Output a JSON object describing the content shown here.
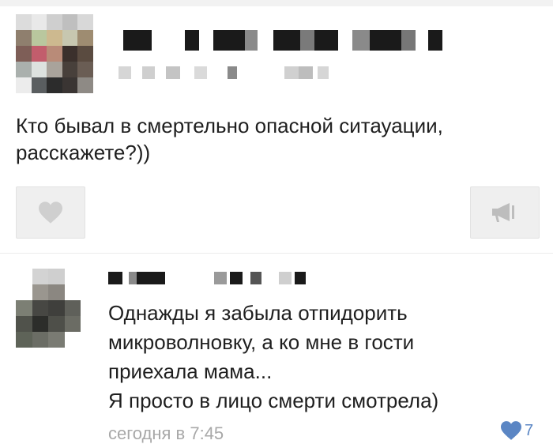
{
  "post": {
    "text_line1": "Кто бывал в смертельно опасной ситауации,",
    "text_line2": "расскажете?))",
    "like_icon": "heart-icon",
    "share_icon": "megaphone-icon"
  },
  "comment": {
    "lines": [
      "Однажды я забыла отпидорить",
      "микроволновку, а ко мне в гости",
      "приехала мама...",
      "Я просто в лицо смерти смотрела)"
    ],
    "time": "сегодня в 7:45",
    "likes": "7",
    "like_color": "#5b86c4"
  }
}
